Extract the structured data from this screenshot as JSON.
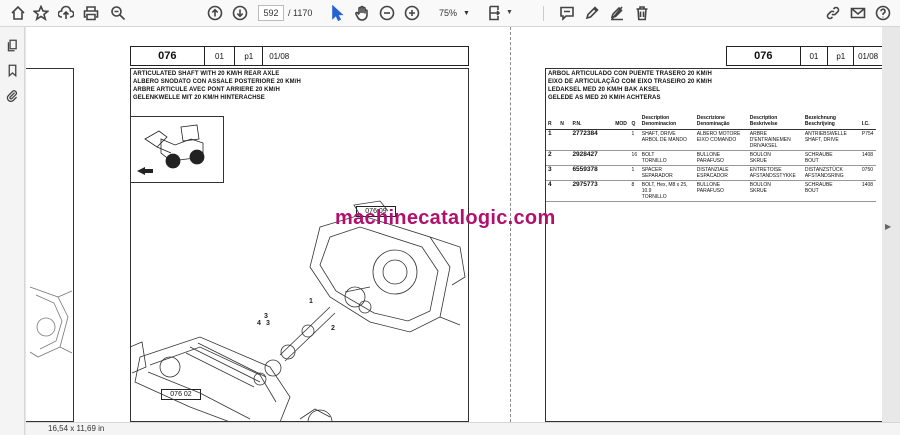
{
  "toolbar": {
    "current_page": "592",
    "page_total": "/ 1170",
    "zoom": "75%",
    "tools": [
      "home-icon",
      "star-icon",
      "upload-icon",
      "print-icon",
      "zoom-search-icon",
      "prev-page-icon",
      "next-page-icon",
      "cursor-icon",
      "hand-icon",
      "zoom-out-icon",
      "zoom-in-icon",
      "page-fit-icon",
      "comment-icon",
      "pen-icon",
      "stamp-icon",
      "trash-icon",
      "link-icon",
      "mail-icon",
      "help-icon"
    ]
  },
  "sidebar": {
    "items": [
      "pages-icon",
      "bookmark-icon",
      "attachment-icon"
    ]
  },
  "left_page": {
    "header": {
      "group": "076",
      "sub": "01",
      "page": "p1",
      "date": "01/08"
    },
    "titles": [
      "ARTICULATED SHAFT WITH 20 KM/H REAR AXLE",
      "ALBERO SNODATO CON ASSALE POSTERIORE 20 KM/H",
      "ARBRE ARTICULE AVEC PONT ARRIERE 20 KM/H",
      "GELENKWELLE MIT 20 KM/H HINTERACHSE"
    ],
    "diagram_labels": [
      "076 09",
      "076 02"
    ],
    "callouts": [
      "1",
      "2",
      "3",
      "4"
    ]
  },
  "right_page": {
    "header": {
      "group": "076",
      "sub": "01",
      "page": "p1",
      "date": "01/08"
    },
    "titles": [
      "ARBOL ARTICULADO CON PUENTE TRASERO 20 KM/H",
      "EIXO DE ARTICULAÇÃO COM EIXO TRASEIRO 20 KM/H",
      "LEDAKSEL MED 20 KM/H BAK AKSEL",
      "GELEDE AS MED 20 KM/H ACHTERAS"
    ],
    "table": {
      "headers": [
        "R",
        "N",
        "P.N.",
        "MOD",
        "Q",
        "Description Denominacion",
        "Descrizione Denominação",
        "Description Beskrivelse",
        "Bezeichnung Beschrijving",
        "I.C."
      ],
      "rows": [
        {
          "r": "1",
          "n": "",
          "pn": "2772384",
          "mod": "",
          "q": "1",
          "c1": "SHAFT, DRIVE",
          "c1b": "ARBOL DE MANDO",
          "c2": "ALBERO MOTORE",
          "c2b": "EIXO COMANDO",
          "c3": "ARBRE D'ENTRAINEMEN",
          "c3b": "DRIVAKSEL",
          "c4": "ANTRIEBSWELLE",
          "c4b": "SHAFT, DRIVE",
          "ic": "P754"
        },
        {
          "r": "2",
          "n": "",
          "pn": "2928427",
          "mod": "",
          "q": "16",
          "c1": "BOLT",
          "c1b": "TORNILLO",
          "c2": "BULLONE",
          "c2b": "PARAFUSO",
          "c3": "BOULON",
          "c3b": "SKRUE",
          "c4": "SCHRAUBE",
          "c4b": "BOUT",
          "ic": "1408"
        },
        {
          "r": "3",
          "n": "",
          "pn": "6559378",
          "mod": "",
          "q": "1",
          "c1": "SPACER",
          "c1b": "SEPARADOR",
          "c2": "DISTANZIALE",
          "c2b": "ESPACADOR",
          "c3": "ENTRETOISE",
          "c3b": "AFSTANDSSTYKKE",
          "c4": "DISTANZSTÜCK",
          "c4b": "AFSTANDSRING",
          "ic": "0750"
        },
        {
          "r": "4",
          "n": "",
          "pn": "2975773",
          "mod": "",
          "q": "8",
          "c1": "BOLT, Hex, M8 x 25, 10.9",
          "c1b": "TORNILLO",
          "c2": "BULLONE",
          "c2b": "PARAFUSO",
          "c3": "BOULON",
          "c3b": "SKRUE",
          "c4": "SCHRAUBE",
          "c4b": "BOUT",
          "ic": "1408"
        }
      ]
    }
  },
  "watermark": "machinecatalogic.com",
  "status": {
    "page_size": "16,54 x 11,69 in"
  }
}
